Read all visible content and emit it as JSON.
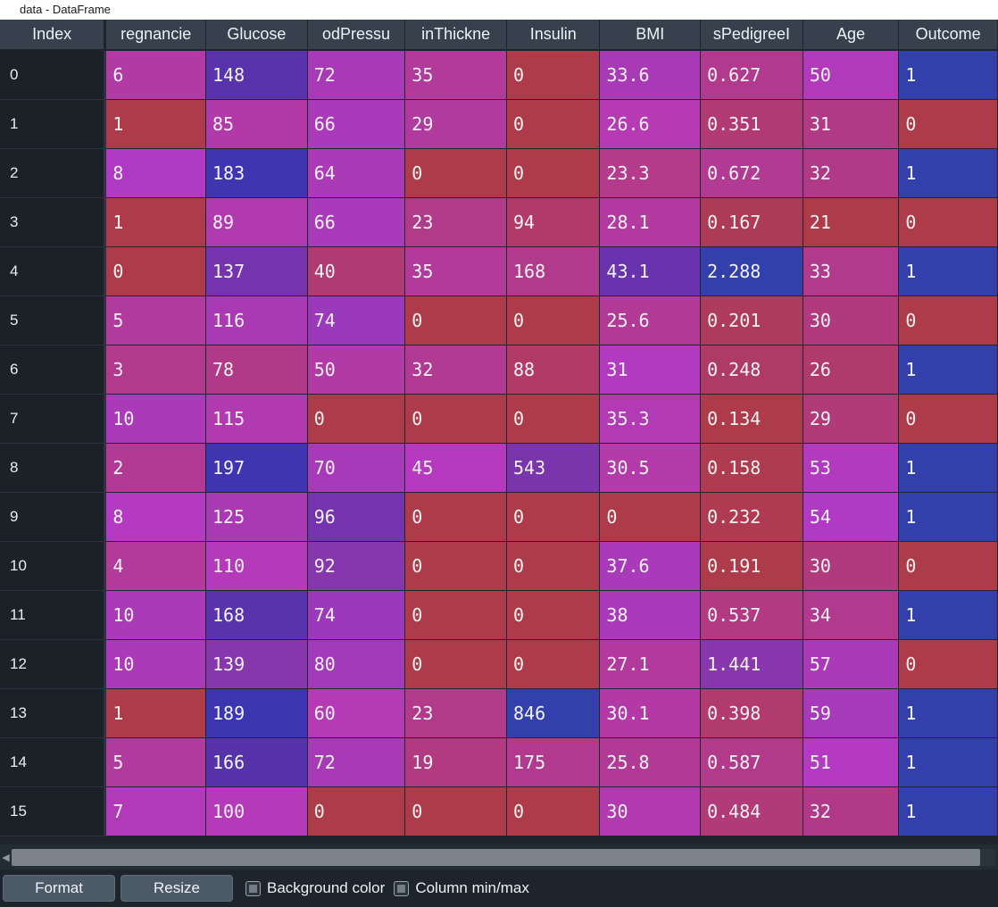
{
  "window": {
    "title": "data - DataFrame"
  },
  "colors": {
    "min": "#ae3b4a",
    "mid": "#a938b5",
    "max": "#3340ab",
    "header_bg": "#36414d",
    "app_bg": "#1e242b",
    "index_bg": "#1c2128",
    "button_bg": "#4c5a68",
    "text": "#f2f2f2"
  },
  "table": {
    "index_header": "Index",
    "headers": [
      "regnancie",
      "Glucose",
      "odPressu",
      "inThickne",
      "Insulin",
      "BMI",
      "sPedigreeI",
      "Age",
      "Outcome"
    ],
    "row_index": [
      "0",
      "1",
      "2",
      "3",
      "4",
      "5",
      "6",
      "7",
      "8",
      "9",
      "10",
      "11",
      "12",
      "13",
      "14",
      "15"
    ],
    "rows": [
      [
        "6",
        "148",
        "72",
        "35",
        "0",
        "33.6",
        "0.627",
        "50",
        "1"
      ],
      [
        "1",
        "85",
        "66",
        "29",
        "0",
        "26.6",
        "0.351",
        "31",
        "0"
      ],
      [
        "8",
        "183",
        "64",
        "0",
        "0",
        "23.3",
        "0.672",
        "32",
        "1"
      ],
      [
        "1",
        "89",
        "66",
        "23",
        "94",
        "28.1",
        "0.167",
        "21",
        "0"
      ],
      [
        "0",
        "137",
        "40",
        "35",
        "168",
        "43.1",
        "2.288",
        "33",
        "1"
      ],
      [
        "5",
        "116",
        "74",
        "0",
        "0",
        "25.6",
        "0.201",
        "30",
        "0"
      ],
      [
        "3",
        "78",
        "50",
        "32",
        "88",
        "31",
        "0.248",
        "26",
        "1"
      ],
      [
        "10",
        "115",
        "0",
        "0",
        "0",
        "35.3",
        "0.134",
        "29",
        "0"
      ],
      [
        "2",
        "197",
        "70",
        "45",
        "543",
        "30.5",
        "0.158",
        "53",
        "1"
      ],
      [
        "8",
        "125",
        "96",
        "0",
        "0",
        "0",
        "0.232",
        "54",
        "1"
      ],
      [
        "4",
        "110",
        "92",
        "0",
        "0",
        "37.6",
        "0.191",
        "30",
        "0"
      ],
      [
        "10",
        "168",
        "74",
        "0",
        "0",
        "38",
        "0.537",
        "34",
        "1"
      ],
      [
        "10",
        "139",
        "80",
        "0",
        "0",
        "27.1",
        "1.441",
        "57",
        "0"
      ],
      [
        "1",
        "189",
        "60",
        "23",
        "846",
        "30.1",
        "0.398",
        "59",
        "1"
      ],
      [
        "5",
        "166",
        "72",
        "19",
        "175",
        "25.8",
        "0.587",
        "51",
        "1"
      ],
      [
        "7",
        "100",
        "0",
        "0",
        "0",
        "30",
        "0.484",
        "32",
        "1"
      ]
    ],
    "cell_colors": [
      [
        "#b13aa4",
        "#5833ab",
        "#a83ab8",
        "#b13a9b",
        "#ae3b4a",
        "#a93ab6",
        "#b13a8f",
        "#b13aba",
        "#3340ab"
      ],
      [
        "#ae3b4a",
        "#b13aa8",
        "#a93ab9",
        "#b13a9e",
        "#ae3b4a",
        "#b53ab3",
        "#b13a75",
        "#b13a84",
        "#ae3b4a"
      ],
      [
        "#b13ac4",
        "#3f35b0",
        "#ab3ab7",
        "#ae3b4a",
        "#ae3b4a",
        "#b43a8c",
        "#b13a93",
        "#b13a88",
        "#3340ab"
      ],
      [
        "#ae3b4a",
        "#b13aaf",
        "#a93ab9",
        "#b13a8a",
        "#b13a6b",
        "#b23aa1",
        "#ae3b56",
        "#ae3b4a",
        "#ae3b4a"
      ],
      [
        "#ae3b4a",
        "#7434ae",
        "#b13a72",
        "#b13a9b",
        "#b13a8d",
        "#6833ad",
        "#3340ab",
        "#b13a8c",
        "#3340ab"
      ],
      [
        "#b13a9e",
        "#a93ab3",
        "#9a39bb",
        "#ae3b4a",
        "#ae3b4a",
        "#b13a97",
        "#ae3b5d",
        "#b13a7f",
        "#ae3b4a"
      ],
      [
        "#b13a8d",
        "#b13a88",
        "#b13aa6",
        "#b13a92",
        "#b13a66",
        "#b23ac0",
        "#ae3b66",
        "#b13a6d",
        "#3340ab"
      ],
      [
        "#aa3ab8",
        "#b13aae",
        "#ae3b4a",
        "#ae3b4a",
        "#ae3b4a",
        "#b23ab4",
        "#ae3b4a",
        "#b13a78",
        "#ae3b4a"
      ],
      [
        "#b13a94",
        "#3f35b0",
        "#a73ab9",
        "#b53ac0",
        "#7a35ad",
        "#b33aa9",
        "#ae3b4f",
        "#b13abe",
        "#3340ab"
      ],
      [
        "#b43ac2",
        "#a93ab4",
        "#7434ae",
        "#ae3b4a",
        "#ae3b4a",
        "#ae3b4a",
        "#ae3b52",
        "#b03ac3",
        "#3340ab"
      ],
      [
        "#b13a9b",
        "#b43ab9",
        "#8737ad",
        "#ae3b4a",
        "#ae3b4a",
        "#a93ab9",
        "#ae3b4a",
        "#b13a7f",
        "#ae3b4a"
      ],
      [
        "#aa3ab8",
        "#5833ab",
        "#9a39bb",
        "#ae3b4a",
        "#ae3b4a",
        "#a93aba",
        "#b13a83",
        "#b13a8f",
        "#3340ab"
      ],
      [
        "#aa3ab8",
        "#8637ac",
        "#a23ab9",
        "#ae3b4a",
        "#ae3b4a",
        "#b13a9c",
        "#8937ac",
        "#ab3ab9",
        "#ae3b4a"
      ],
      [
        "#ae3b4a",
        "#3b35b0",
        "#b43ab6",
        "#b13a8a",
        "#3340ab",
        "#b33aa6",
        "#b13a6e",
        "#a73ab8",
        "#3340ab"
      ],
      [
        "#b13a9e",
        "#5733ab",
        "#a83ab8",
        "#b13a80",
        "#b13a8e",
        "#b13a97",
        "#b13a8a",
        "#b43ac4",
        "#3340ab"
      ],
      [
        "#b13ab8",
        "#b43ab9",
        "#ae3b4a",
        "#ae3b4a",
        "#ae3b4a",
        "#b23aaf",
        "#b13a79",
        "#b13a88",
        "#3340ab"
      ]
    ]
  },
  "scrollbar": {
    "left_arrow_icon": "chevron-left-icon"
  },
  "footer": {
    "format_button": "Format",
    "resize_button": "Resize",
    "background_color_label": "Background color",
    "background_color_checked": true,
    "column_minmax_label": "Column min/max",
    "column_minmax_checked": true
  }
}
